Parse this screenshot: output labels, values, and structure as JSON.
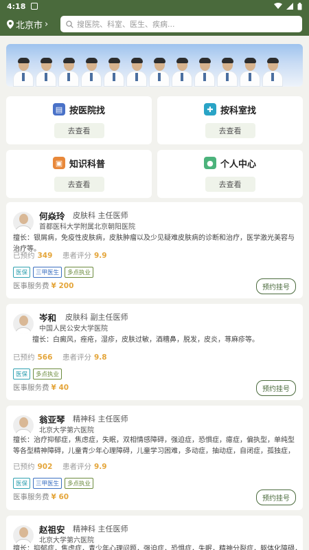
{
  "status": {
    "time": "4:18"
  },
  "header": {
    "city": "北京市",
    "search_placeholder": "搜医院、科室、医生、疾病..."
  },
  "categories": [
    {
      "label": "按医院找",
      "action": "去查看",
      "icon": "hospital-icon",
      "color": "#4a72c8"
    },
    {
      "label": "按科室找",
      "action": "去查看",
      "icon": "department-icon",
      "color": "#2aa4c6"
    },
    {
      "label": "知识科普",
      "action": "去查看",
      "icon": "book-icon",
      "color": "#e8883a"
    },
    {
      "label": "个人中心",
      "action": "去查看",
      "icon": "user-icon",
      "color": "#4cb37c"
    }
  ],
  "doctors": [
    {
      "name": "何焱玲",
      "dept": "皮肤科",
      "title": "主任医师",
      "hospital": "首都医科大学附属北京朝阳医院",
      "specialty": "擅长：银屑病，免疫性皮肤病，皮肤肿瘤以及少见疑难皮肤病的诊断和治疗，医学激光美容与治疗等。",
      "booked_label": "已预约",
      "booked": "349",
      "rating_label": "患者评分",
      "rating": "9.9",
      "tags": [
        "医保",
        "三甲医生",
        "多点执业"
      ],
      "fee_label": "医事服务费",
      "fee": "¥ 200",
      "book_label": "预约挂号"
    },
    {
      "name": "岑和",
      "dept": "皮肤科",
      "title": "副主任医师",
      "hospital": "中国人民公安大学医院",
      "specialty": "擅长：白癜风，痤疮，湿疹，皮肤过敏，酒糟鼻，脱发，皮炎，荨麻疹等。",
      "booked_label": "已预约",
      "booked": "566",
      "rating_label": "患者评分",
      "rating": "9.8",
      "tags": [
        "医保",
        "多点执业"
      ],
      "fee_label": "医事服务费",
      "fee": "¥ 40",
      "book_label": "预约挂号"
    },
    {
      "name": "翁亚琴",
      "dept": "精神科",
      "title": "主任医师",
      "hospital": "北京大学第六医院",
      "specialty": "擅长：治疗抑郁症，焦虑症，失眠，双相情感障碍，强迫症，恐惧症，癔症，偏执型，单纯型等各型精神障碍，儿童青少年心理障碍，儿童学习困难，多动症，抽动症，自闭症，孤独症，精神发育迟缓等…",
      "booked_label": "已预约",
      "booked": "902",
      "rating_label": "患者评分",
      "rating": "9.9",
      "tags": [
        "医保",
        "三甲医生",
        "多点执业"
      ],
      "fee_label": "医事服务费",
      "fee": "¥ 60",
      "book_label": "预约挂号"
    },
    {
      "name": "赵祖安",
      "dept": "精神科",
      "title": "主任医师",
      "hospital": "北京大学第六医院",
      "specialty": "擅长：抑郁症，焦虑症，青少年心理问题，强迫症，恐惧症，失眠，精神分裂症，躯体化障碍，双相情…"
    }
  ]
}
